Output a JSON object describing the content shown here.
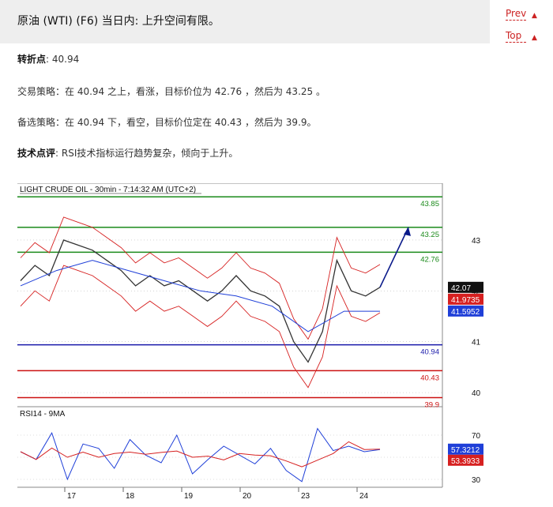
{
  "header": {
    "title": "原油 (WTI) (F6) 当日内: 上升空间有限。"
  },
  "nav": {
    "prev": "Prev",
    "top": "Top",
    "prev_arrow": "▲",
    "top_arrow": "▲"
  },
  "analysis": {
    "pivot_label": "转折点",
    "pivot_value": ": 40.94",
    "strategy_label": "交易策略",
    "strategy_text": "：在 40.94 之上，看涨，目标价位为 42.76 ，然后为 43.25 。",
    "alternative_label": "备选策略",
    "alternative_text": "：在 40.94 下，看空，目标价位定在 40.43 ，然后为 39.9。",
    "comment_label": "技术点评",
    "comment_text": ": RSI技术指标运行趋势复杂，倾向于上升。"
  },
  "chart_data": {
    "type": "line",
    "title": "LIGHT CRUDE OIL - 30min - 7:14:32 AM (UTC+2)",
    "x_ticks": [
      "17",
      "18",
      "19",
      "20",
      "23",
      "24"
    ],
    "y_ticks": [
      "43",
      "42",
      "41",
      "40"
    ],
    "ylim": [
      39.8,
      43.9
    ],
    "levels": [
      {
        "label": "43.85",
        "value": 43.85,
        "color": "#1a8a1a"
      },
      {
        "label": "43.25",
        "value": 43.25,
        "color": "#1a8a1a"
      },
      {
        "label": "42.76",
        "value": 42.76,
        "color": "#1a8a1a"
      },
      {
        "label": "40.94",
        "value": 40.94,
        "color": "#1a1aaa"
      },
      {
        "label": "40.43",
        "value": 40.43,
        "color": "#cc1111"
      },
      {
        "label": "39.9",
        "value": 39.9,
        "color": "#cc1111"
      }
    ],
    "price_badges": [
      {
        "label": "42.07",
        "value": 42.07,
        "color": "#111111"
      },
      {
        "label": "41.9735",
        "value": 41.9735,
        "color": "#d62020"
      },
      {
        "label": "41.5952",
        "value": 41.5952,
        "color": "#1f3fd8"
      }
    ],
    "series": [
      {
        "name": "",
        "x": [
          0,
          4,
          8,
          12,
          16,
          20,
          24,
          28,
          32,
          36,
          40,
          44,
          48,
          52,
          56,
          60,
          64,
          68,
          72,
          76,
          80,
          84,
          88,
          92,
          96,
          100
        ],
        "y": [
          42.2,
          42.5,
          42.3,
          43.0,
          42.9,
          42.8,
          42.6,
          42.4,
          42.1,
          42.3,
          42.1,
          42.2,
          42.0,
          41.8,
          42.0,
          42.3,
          42.0,
          41.9,
          41.7,
          41.0,
          40.6,
          41.2,
          42.6,
          42.0,
          41.9,
          42.07
        ],
        "color": "#333333"
      },
      {
        "name": "",
        "x": [
          0,
          10,
          20,
          30,
          40,
          50,
          60,
          70,
          80,
          90,
          100
        ],
        "y": [
          42.1,
          42.4,
          42.6,
          42.4,
          42.2,
          42.0,
          41.9,
          41.7,
          41.2,
          41.6,
          41.6
        ],
        "color": "#1f3fd8"
      }
    ],
    "rsi": {
      "title": "RSI14 - 9MA",
      "y_ticks": [
        "70",
        "30"
      ],
      "badges": [
        {
          "label": "57.3212",
          "color": "#1f3fd8"
        },
        {
          "label": "53.3933",
          "color": "#d62020"
        }
      ]
    }
  }
}
